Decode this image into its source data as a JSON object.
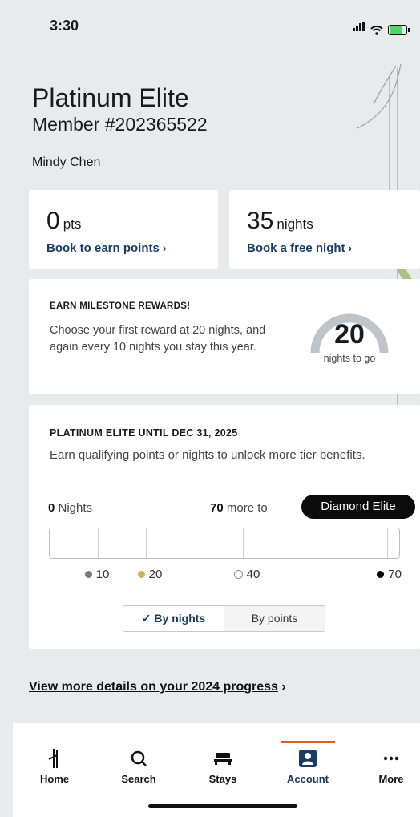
{
  "status_bar": {
    "time": "3:30"
  },
  "header": {
    "tier": "Platinum Elite",
    "member_number": "Member #202365522",
    "name": "Mindy Chen"
  },
  "points_card": {
    "value": "0",
    "unit": "pts",
    "link": "Book to earn points"
  },
  "nights_card": {
    "value": "35",
    "unit": "nights",
    "link": "Book a free night"
  },
  "milestone": {
    "heading": "EARN MILESTONE REWARDS!",
    "body": "Choose your first reward at 20 nights, and again every 10 nights you stay this year.",
    "gauge_value": "20",
    "gauge_label": "nights to go",
    "gauge_progress": 0,
    "colors": {
      "track": "#bfc4c8"
    }
  },
  "tier_status": {
    "heading": "PLATINUM ELITE UNTIL DEC 31, 2025",
    "body": "Earn qualifying points or nights to unlock more tier benefits.",
    "current_value": "0",
    "current_label": "Nights",
    "remaining_value": "70",
    "remaining_label": "more to",
    "next_tier": "Diamond Elite",
    "progress_nights": 0,
    "max_nights": 70,
    "markers": [
      {
        "label": "10",
        "color": "#7a7a7a",
        "style": "filled"
      },
      {
        "label": "20",
        "color": "#c9b45c",
        "style": "filled"
      },
      {
        "label": "40",
        "color": "#ffffff",
        "style": "outline"
      },
      {
        "label": "70",
        "color": "#000000",
        "style": "filled"
      }
    ],
    "toggle": {
      "active": "By nights",
      "inactive": "By points"
    }
  },
  "progress_link": "View more details on your 2024 progress",
  "tab_bar": {
    "tabs": [
      {
        "label": "Home",
        "icon": "hilton-logo-icon"
      },
      {
        "label": "Search",
        "icon": "search-icon"
      },
      {
        "label": "Stays",
        "icon": "bed-icon"
      },
      {
        "label": "Account",
        "icon": "account-icon",
        "active": true
      },
      {
        "label": "More",
        "icon": "more-dots-icon"
      }
    ],
    "accent_color": "#e35a2a"
  }
}
